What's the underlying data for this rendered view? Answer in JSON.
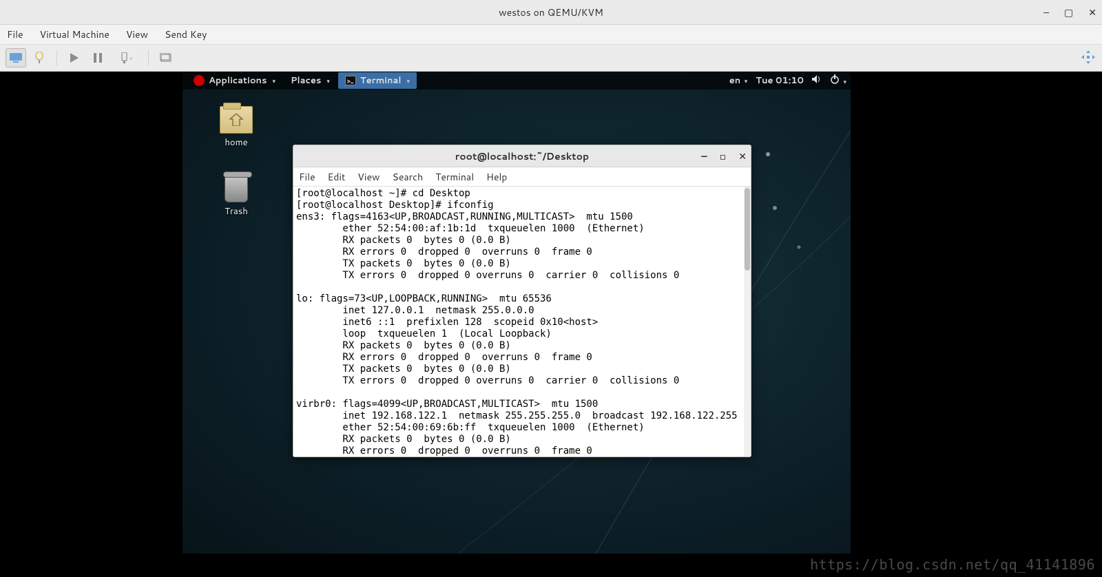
{
  "host_window": {
    "title": "westos on QEMU/KVM",
    "menus": {
      "file": "File",
      "vm": "Virtual Machine",
      "view": "View",
      "sendkey": "Send Key"
    }
  },
  "gnome_bar": {
    "applications": "Applications",
    "places": "Places",
    "terminal": "Terminal",
    "lang": "en",
    "clock": "Tue 01:10"
  },
  "desktop_icons": {
    "home": "home",
    "trash": "Trash"
  },
  "terminal": {
    "title": "root@localhost:~/Desktop",
    "menus": {
      "file": "File",
      "edit": "Edit",
      "view": "View",
      "search": "Search",
      "terminal": "Terminal",
      "help": "Help"
    },
    "content": "[root@localhost ~]# cd Desktop\n[root@localhost Desktop]# ifconfig\nens3: flags=4163<UP,BROADCAST,RUNNING,MULTICAST>  mtu 1500\n        ether 52:54:00:af:1b:1d  txqueuelen 1000  (Ethernet)\n        RX packets 0  bytes 0 (0.0 B)\n        RX errors 0  dropped 0  overruns 0  frame 0\n        TX packets 0  bytes 0 (0.0 B)\n        TX errors 0  dropped 0 overruns 0  carrier 0  collisions 0\n\nlo: flags=73<UP,LOOPBACK,RUNNING>  mtu 65536\n        inet 127.0.0.1  netmask 255.0.0.0\n        inet6 ::1  prefixlen 128  scopeid 0x10<host>\n        loop  txqueuelen 1  (Local Loopback)\n        RX packets 0  bytes 0 (0.0 B)\n        RX errors 0  dropped 0  overruns 0  frame 0\n        TX packets 0  bytes 0 (0.0 B)\n        TX errors 0  dropped 0 overruns 0  carrier 0  collisions 0\n\nvirbr0: flags=4099<UP,BROADCAST,MULTICAST>  mtu 1500\n        inet 192.168.122.1  netmask 255.255.255.0  broadcast 192.168.122.255\n        ether 52:54:00:69:6b:ff  txqueuelen 1000  (Ethernet)\n        RX packets 0  bytes 0 (0.0 B)\n        RX errors 0  dropped 0  overruns 0  frame 0"
  },
  "watermark": "https://blog.csdn.net/qq_41141896"
}
